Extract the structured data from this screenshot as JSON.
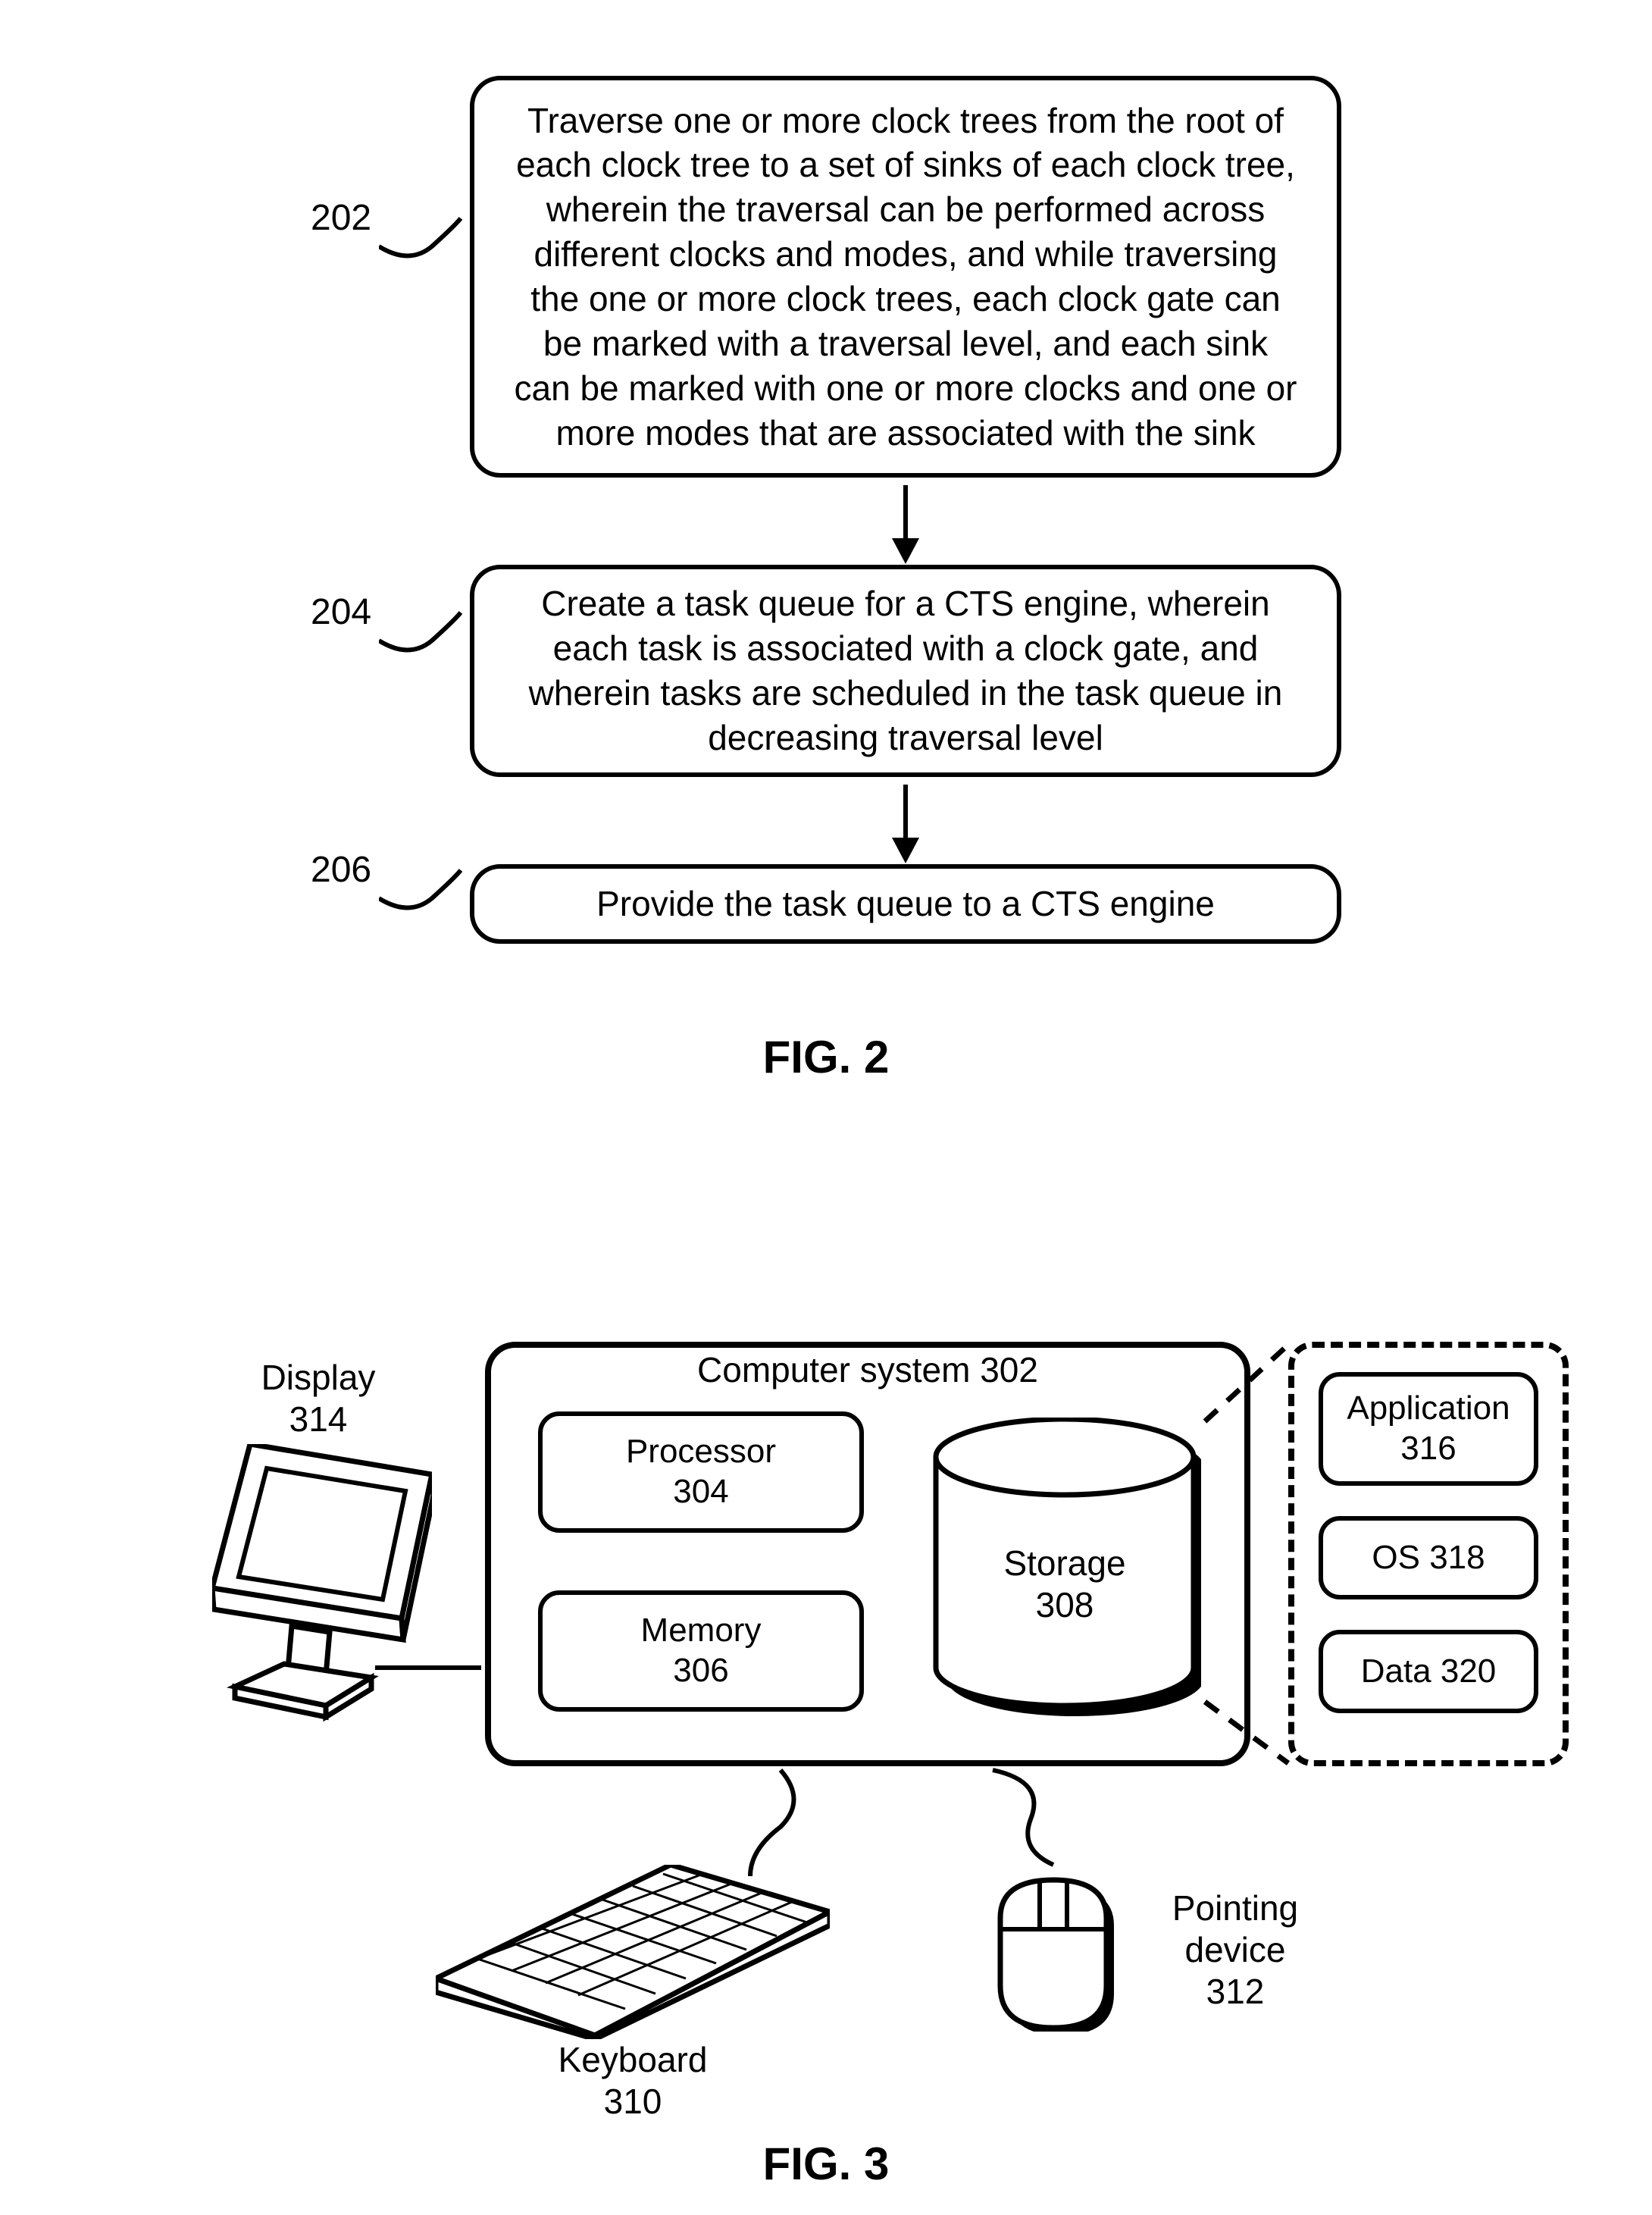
{
  "fig2": {
    "caption": "FIG. 2",
    "ref202": "202",
    "ref204": "204",
    "ref206": "206",
    "box202": "Traverse one or more clock trees from the root of each clock tree to a set of sinks of each clock tree, wherein the traversal can be performed across different clocks and modes, and while traversing the one or more clock trees, each clock gate can be marked with a traversal level, and each sink can be marked with one or more clocks and one or more modes that are associated with the sink",
    "box204": "Create a task queue for a CTS engine, wherein each task is associated with a clock gate, and wherein tasks are scheduled in the task queue in decreasing traversal level",
    "box206": "Provide the task queue to a CTS engine"
  },
  "fig3": {
    "caption": "FIG. 3",
    "computer_system": "Computer system 302",
    "processor": "Processor\n304",
    "memory": "Memory\n306",
    "storage": "Storage\n308",
    "application": "Application\n316",
    "os": "OS 318",
    "data": "Data 320",
    "display": "Display\n314",
    "keyboard": "Keyboard\n310",
    "pointing": "Pointing\ndevice\n312"
  }
}
